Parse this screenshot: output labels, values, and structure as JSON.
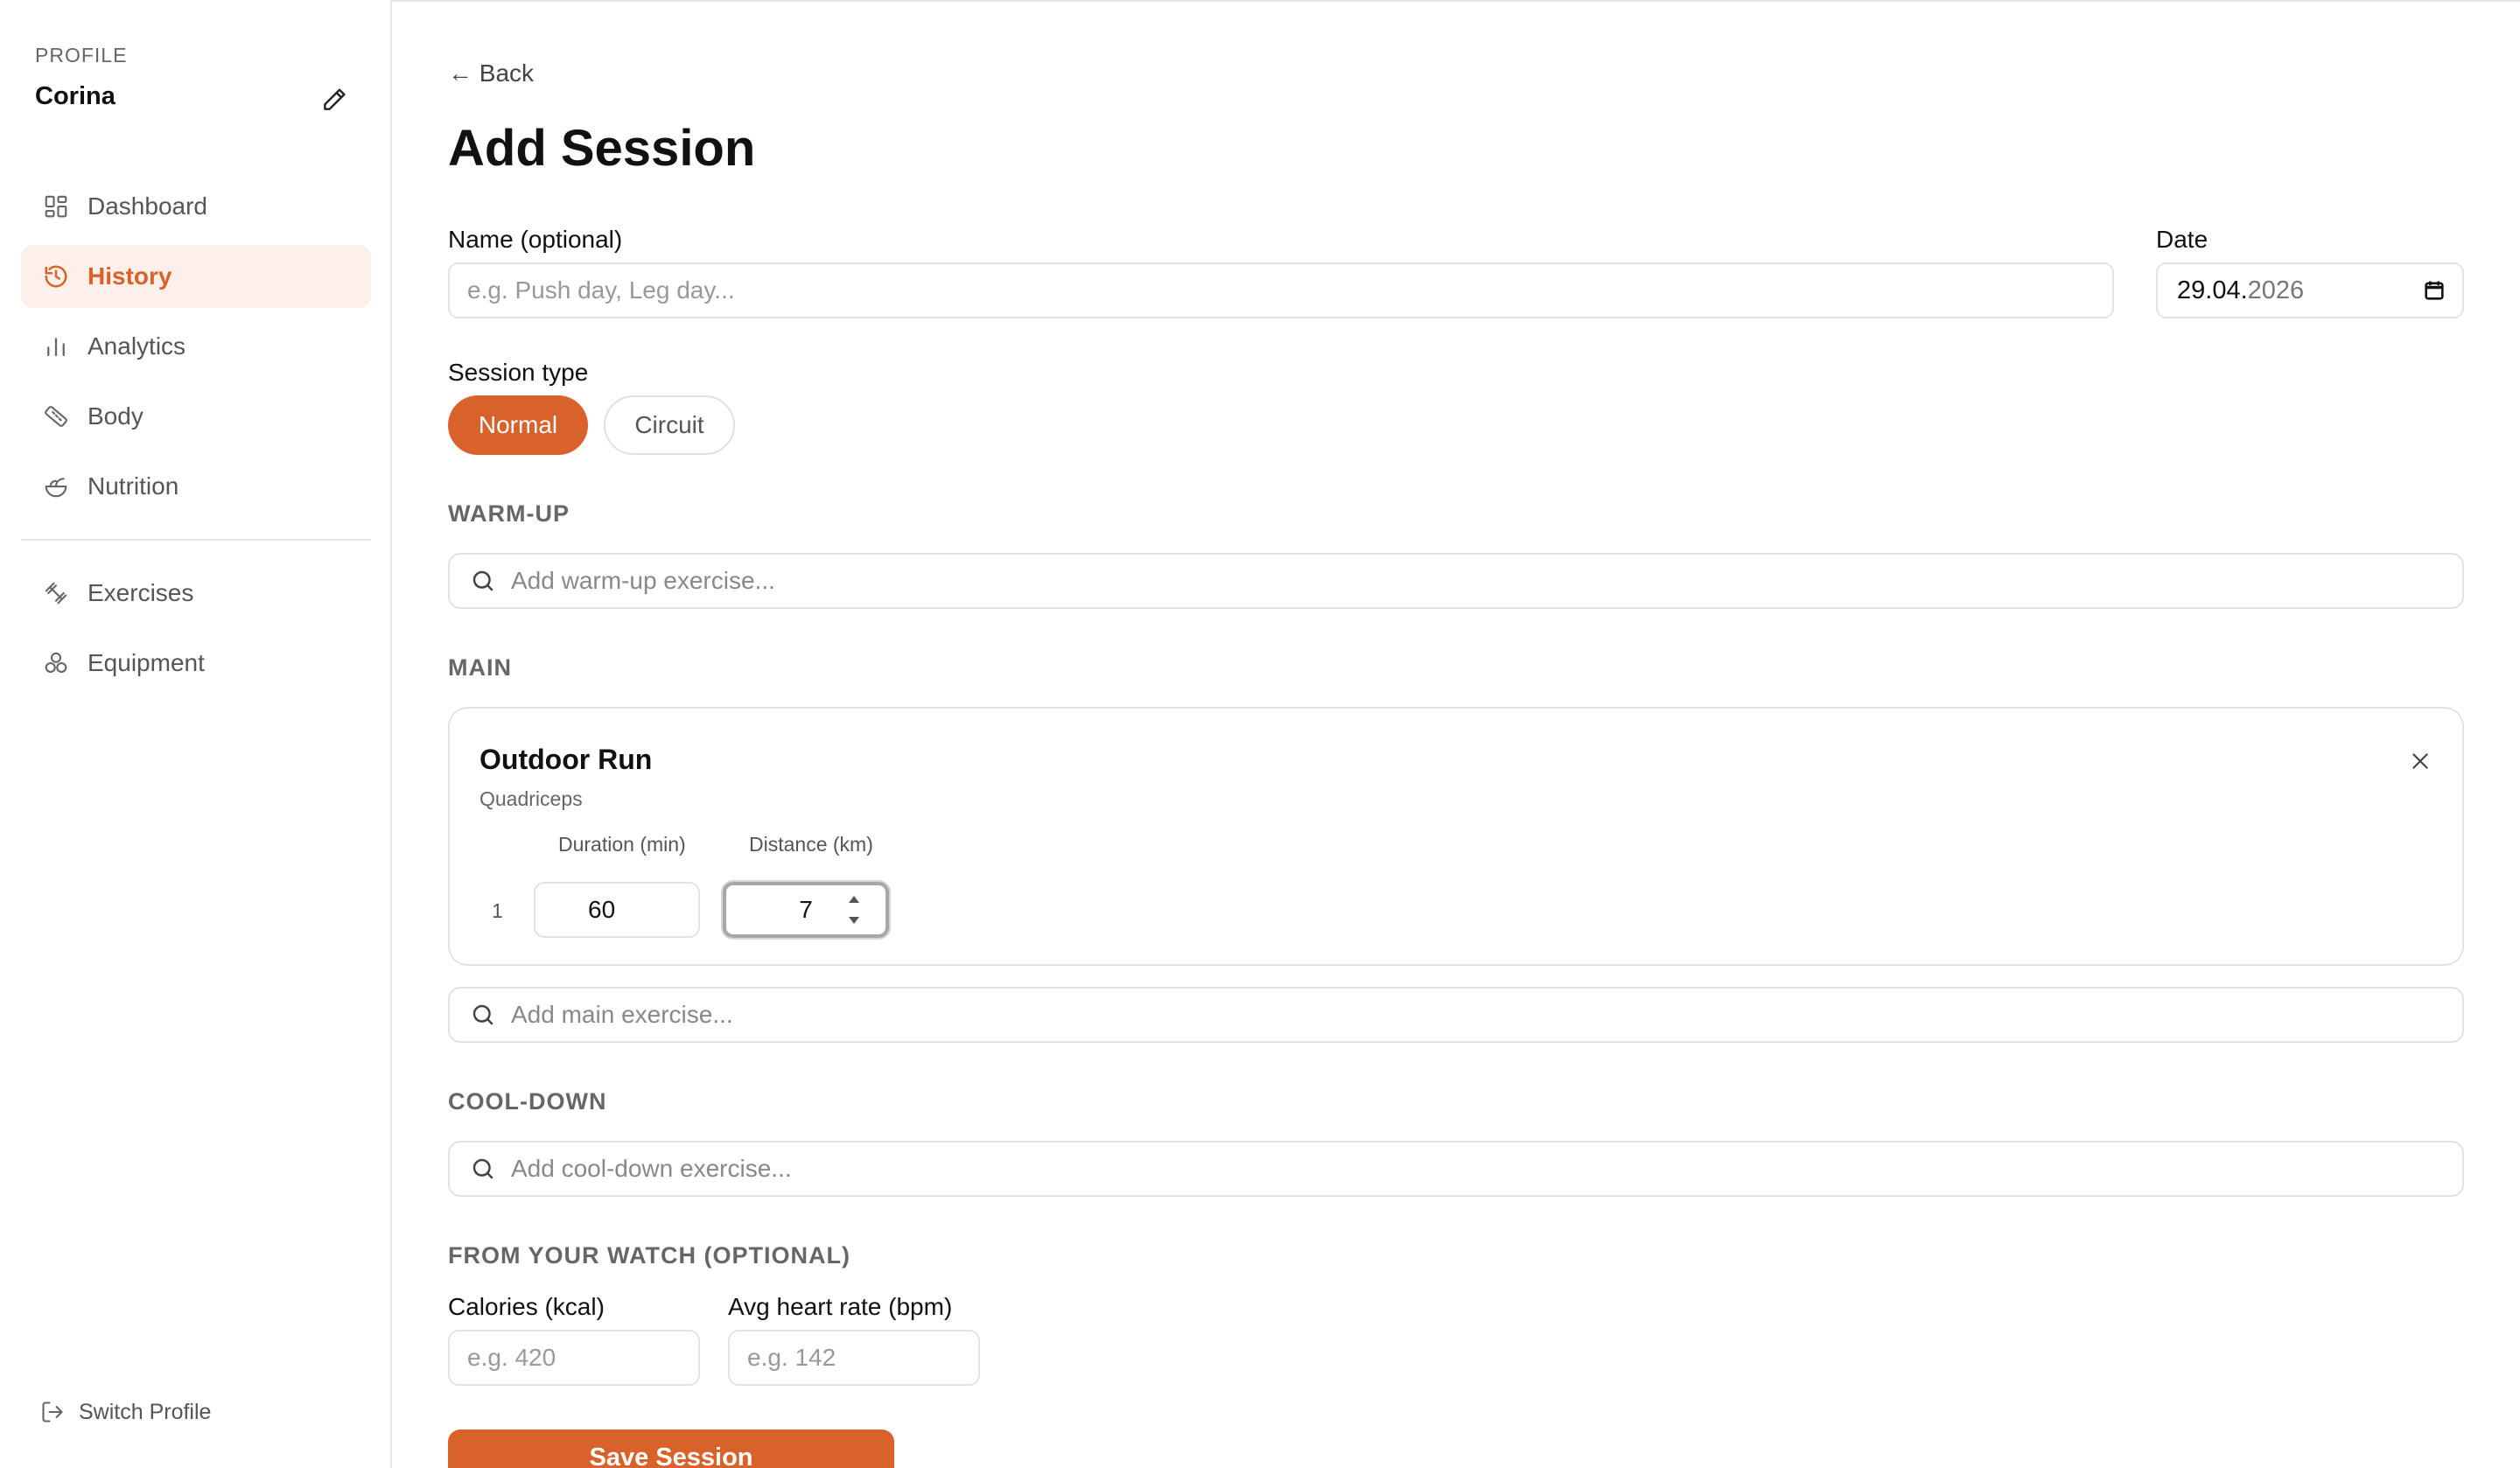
{
  "colors": {
    "accent": "#d9622a",
    "accent_soft": "#fdf0ea",
    "border": "#e2e2e2"
  },
  "sidebar": {
    "profile_label": "PROFILE",
    "profile_name": "Corina",
    "items": [
      {
        "label": "Dashboard",
        "icon": "dashboard-icon",
        "active": false
      },
      {
        "label": "History",
        "icon": "history-icon",
        "active": true
      },
      {
        "label": "Analytics",
        "icon": "analytics-icon",
        "active": false
      },
      {
        "label": "Body",
        "icon": "tape-measure-icon",
        "active": false
      },
      {
        "label": "Nutrition",
        "icon": "salad-bowl-icon",
        "active": false
      },
      {
        "label": "Exercises",
        "icon": "dumbbell-icon",
        "active": false
      },
      {
        "label": "Equipment",
        "icon": "weights-icon",
        "active": false
      }
    ],
    "switch_profile": "Switch Profile"
  },
  "main": {
    "back": "← Back",
    "title": "Add Session",
    "name_label": "Name (optional)",
    "name_placeholder": "e.g. Push day, Leg day...",
    "date_label": "Date",
    "date_day_month": "29.04.",
    "date_year": "2026",
    "session_type_label": "Session type",
    "session_types": {
      "normal": "Normal",
      "circuit": "Circuit"
    },
    "warmup": {
      "heading": "WARM-UP",
      "placeholder": "Add warm-up exercise..."
    },
    "main_section": {
      "heading": "MAIN",
      "placeholder": "Add main exercise...",
      "exercise": {
        "name": "Outdoor Run",
        "muscle": "Quadriceps",
        "col_duration": "Duration (min)",
        "col_distance": "Distance (km)",
        "sets": [
          {
            "number": "1",
            "duration": "60",
            "distance": "7"
          }
        ]
      }
    },
    "cooldown": {
      "heading": "COOL-DOWN",
      "placeholder": "Add cool-down exercise..."
    },
    "watch": {
      "heading": "FROM YOUR WATCH (OPTIONAL)",
      "calories_label": "Calories (kcal)",
      "calories_placeholder": "e.g. 420",
      "hr_label": "Avg heart rate (bpm)",
      "hr_placeholder": "e.g. 142"
    },
    "save": "Save Session"
  }
}
